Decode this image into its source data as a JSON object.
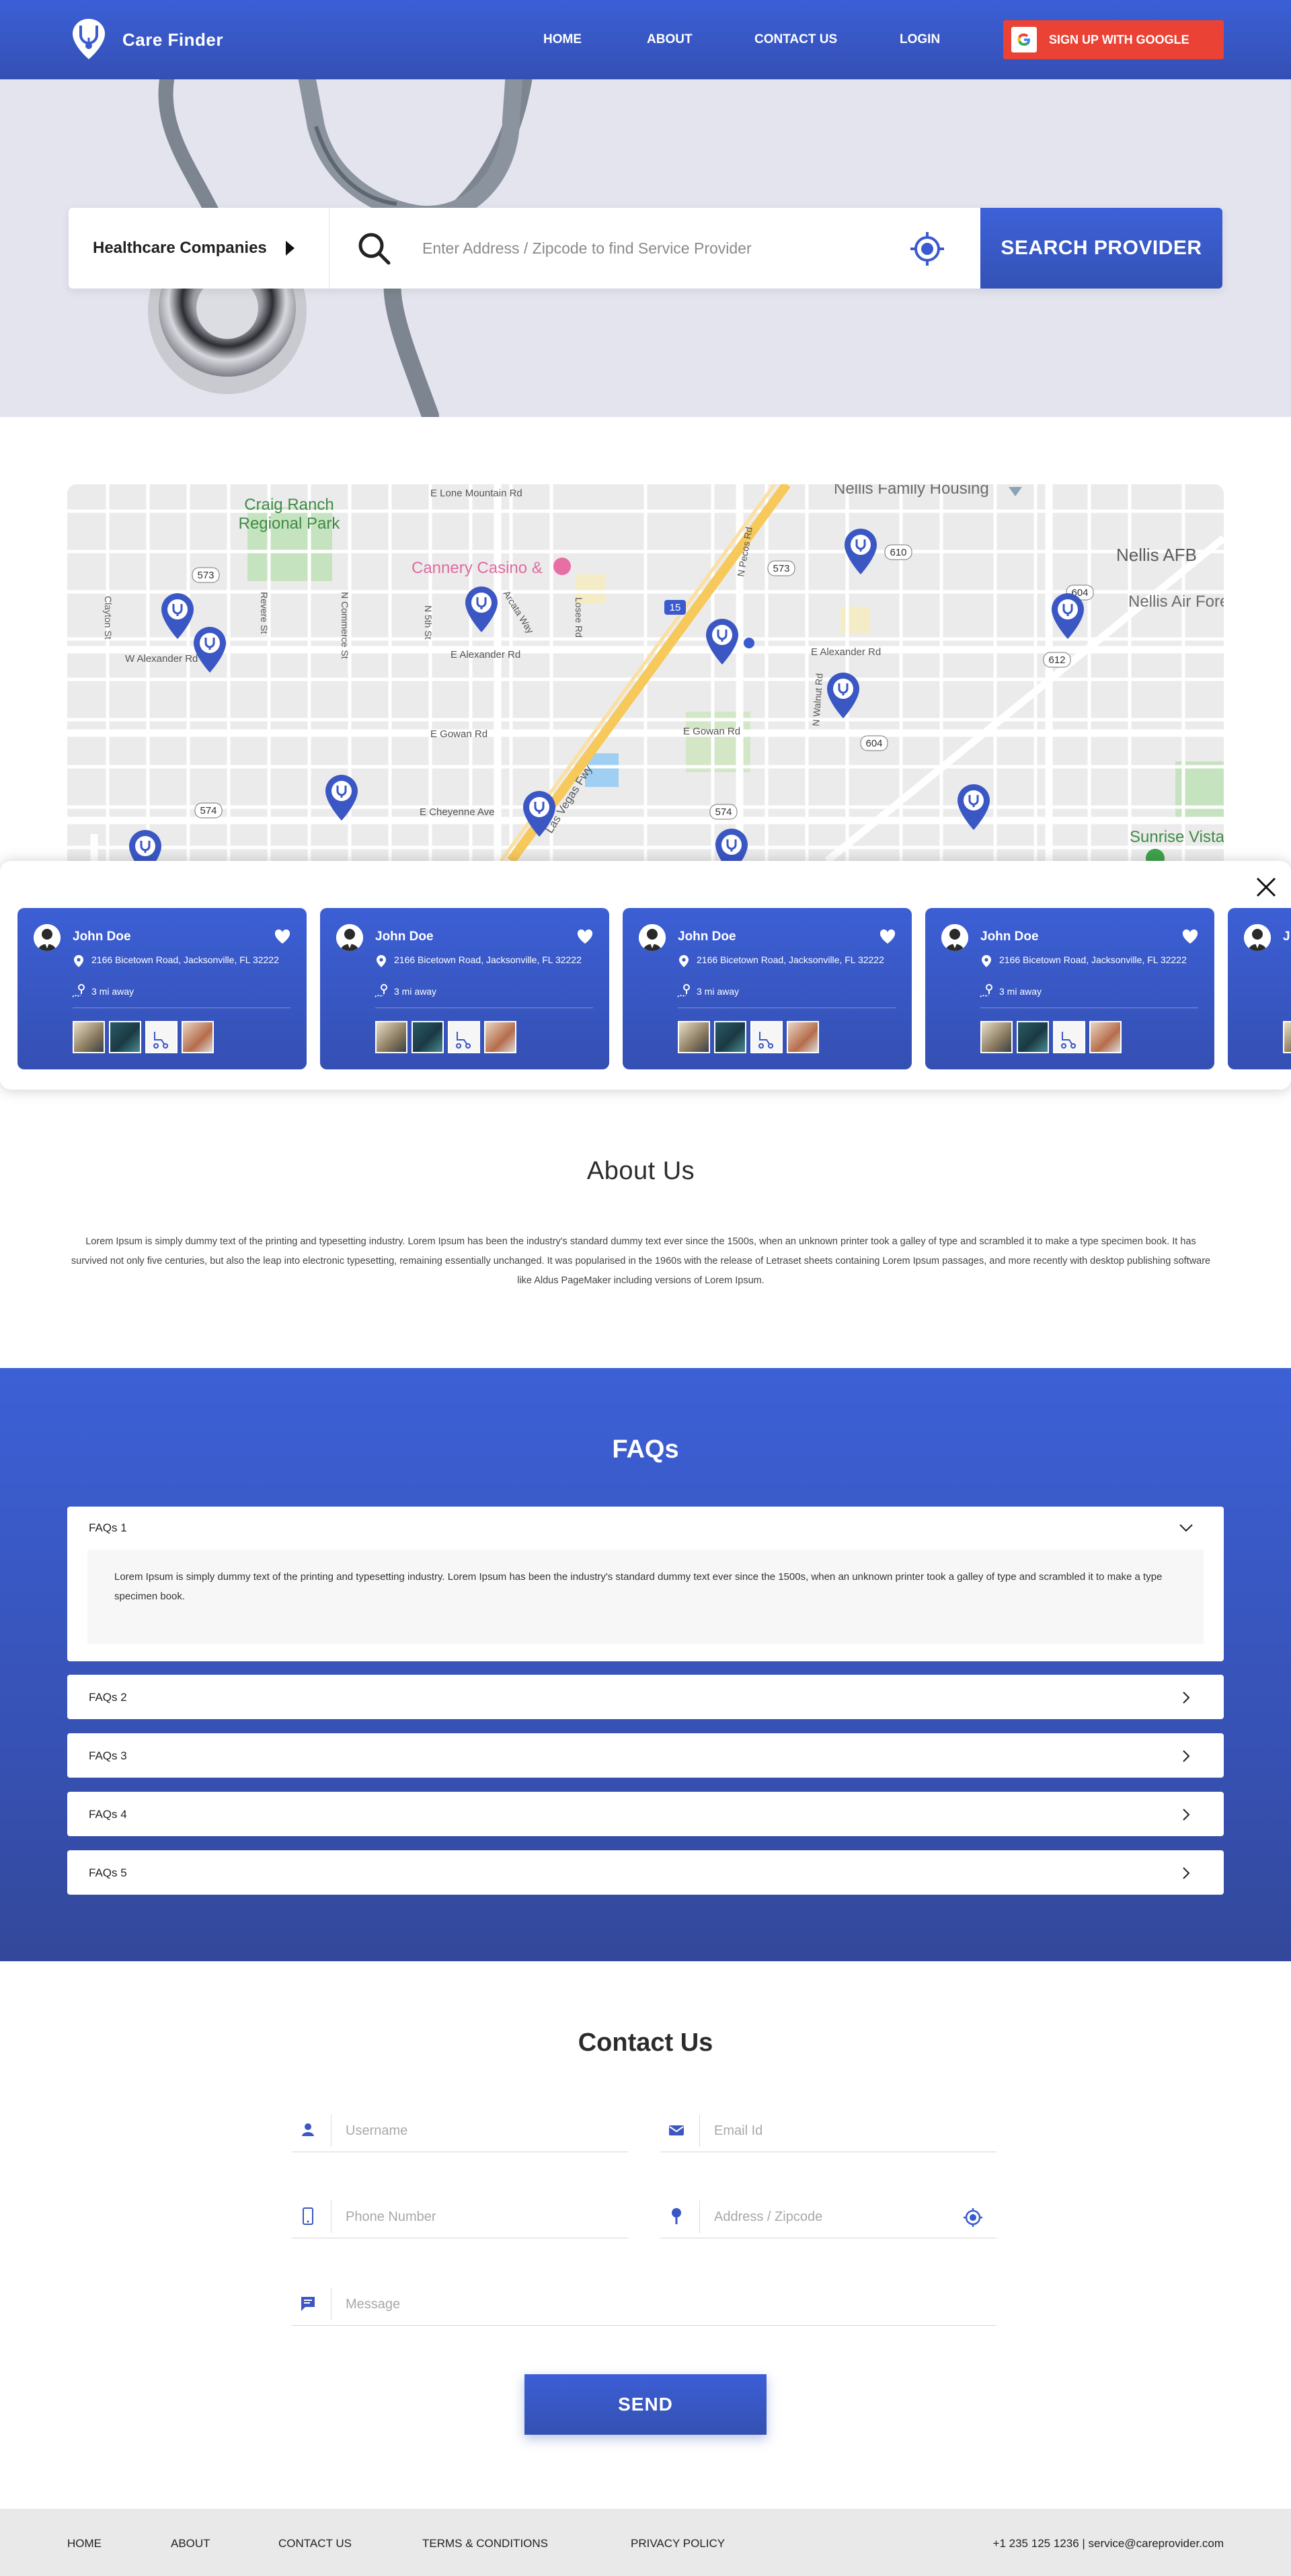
{
  "brand": {
    "name": "Care Finder",
    "accent": "#3a5ad0",
    "google_red": "#ea4335"
  },
  "nav": {
    "links": [
      "HOME",
      "ABOUT",
      "CONTACT US",
      "LOGIN"
    ],
    "google_button": "SIGN UP WITH GOOGLE"
  },
  "search": {
    "category": "Healthcare Companies",
    "placeholder": "Enter Address / Zipcode to find Service Provider",
    "button": "SEARCH PROVIDER"
  },
  "map": {
    "labels": {
      "park": "Craig Ranch\nRegional Park",
      "park_line1": "Craig Ranch",
      "park_line2": "Regional Park",
      "casino": "Cannery Casino &",
      "housing": "Nellis Family Housing",
      "afb": "Nellis AFB",
      "air_force": "Nellis Air Fore",
      "sunrise": "Sunrise Vista",
      "lone_mountain": "E Lone Mountain Rd",
      "alexander_w": "W Alexander Rd",
      "alexander_e": "E Alexander Rd",
      "alexander_e2": "E Alexander Rd",
      "gowan": "E Gowan Rd",
      "gowan2": "E Gowan Rd",
      "cheyenne": "E Cheyenne Ave",
      "fwy": "Las Vegas Fwy",
      "5th": "N 5th St",
      "commerce": "N Commerce St",
      "revere": "Revere St",
      "clayton": "Clayton St",
      "losee": "Losee Rd",
      "pecos": "N Pecos Rd",
      "walnut": "N Walnut Rd",
      "arcata": "Arcata Way",
      "r573a": "573",
      "r573b": "573",
      "r610": "610",
      "r604a": "604",
      "r604b": "604",
      "r574a": "574",
      "r574b": "574",
      "r15": "15",
      "r612": "612"
    }
  },
  "providers": [
    {
      "name": "John Doe",
      "address": "2166  Bicetown Road, Jacksonville, FL 32222",
      "distance": "3 mi away"
    },
    {
      "name": "John Doe",
      "address": "2166  Bicetown Road, Jacksonville, FL 32222",
      "distance": "3 mi away"
    },
    {
      "name": "John Doe",
      "address": "2166  Bicetown Road, Jacksonville, FL 32222",
      "distance": "3 mi away"
    },
    {
      "name": "John Doe",
      "address": "2166  Bicetown Road, Jacksonville, FL 32222",
      "distance": "3 mi away"
    },
    {
      "name": "J",
      "address": "",
      "distance": ""
    }
  ],
  "about": {
    "title": "About Us",
    "text": "Lorem Ipsum is simply dummy text of the printing and typesetting industry. Lorem Ipsum has been the industry's standard dummy text ever since the 1500s, when an unknown printer took a galley of type and scrambled it to make a type specimen book. It has survived not only five centuries, but also the leap into electronic typesetting, remaining essentially unchanged. It was popularised in the 1960s with the release of Letraset sheets containing Lorem Ipsum passages, and more recently with desktop publishing software like Aldus PageMaker including versions of Lorem Ipsum."
  },
  "faq": {
    "title": "FAQs",
    "items": [
      {
        "q": "FAQs 1",
        "a": "Lorem Ipsum is simply dummy text of the printing and typesetting industry. Lorem Ipsum has been the industry's standard dummy text ever since the 1500s, when an unknown printer took a galley of type and scrambled it to make a type specimen book."
      },
      {
        "q": "FAQs 2"
      },
      {
        "q": "FAQs 3"
      },
      {
        "q": "FAQs 4"
      },
      {
        "q": "FAQs 5"
      }
    ]
  },
  "contact": {
    "title": "Contact Us",
    "username": "Username",
    "email": "Email Id",
    "phone": "Phone Number",
    "address": "Address / Zipcode",
    "message": "Message",
    "send": "SEND"
  },
  "footer": {
    "links": [
      "HOME",
      "ABOUT",
      "CONTACT US",
      "TERMS & CONDITIONS",
      "PRIVACY POLICY"
    ],
    "contact": "+1 235 125 1236 | service@careprovider.com"
  }
}
